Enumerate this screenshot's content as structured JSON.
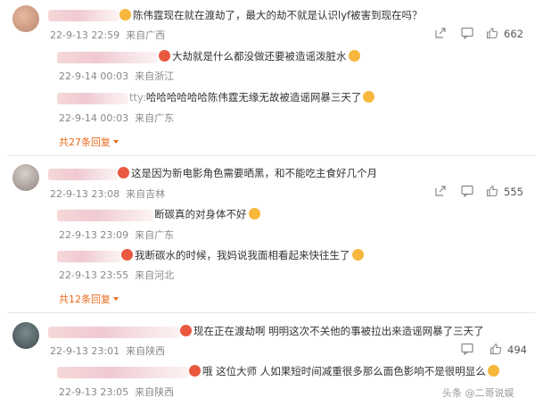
{
  "comments": [
    {
      "text": "陈伟霆现在就在渡劫了，最大的劫不就是认识lyf被害到现在吗？",
      "date": "22-9-13 22:59",
      "location": "来自广西",
      "likes": "662",
      "replies": [
        {
          "text": "大劫就是什么都没做还要被造谣泼脏水",
          "date": "22-9-14 00:03",
          "location": "来自浙江"
        },
        {
          "name_tail": "tty:",
          "text": "哈哈哈哈哈哈陈伟霆无缘无故被造谣网暴三天了",
          "date": "22-9-14 00:03",
          "location": "来自广东"
        }
      ],
      "more": "共27条回复"
    },
    {
      "text": "这是因为新电影角色需要晒黑，和不能吃主食好几个月",
      "date": "22-9-13 23:08",
      "location": "来自吉林",
      "likes": "555",
      "replies": [
        {
          "text": "断碳真的对身体不好",
          "date": "22-9-13 23:09",
          "location": "来自广东"
        },
        {
          "text": "我断碳水的时候，我妈说我面相看起来快往生了",
          "date": "22-9-13 23:55",
          "location": "来自河北"
        }
      ],
      "more": "共12条回复"
    },
    {
      "text": "现在正在渡劫啊 明明这次不关他的事被拉出来造谣网暴了三天了",
      "date": "22-9-13 23:01",
      "location": "来自陕西",
      "likes": "494",
      "replies": [
        {
          "text": "哦 这位大师 人如果短时间减重很多那么面色影响不是很明显么",
          "date": "22-9-13 23:05",
          "location": "来自陕西"
        }
      ]
    }
  ],
  "watermark": "头条 @二哥说娱",
  "colors": {
    "accent": "#e86a1c",
    "meta": "#888888"
  },
  "icons": [
    "share-icon",
    "comment-icon",
    "like-icon",
    "emoji-icon"
  ]
}
